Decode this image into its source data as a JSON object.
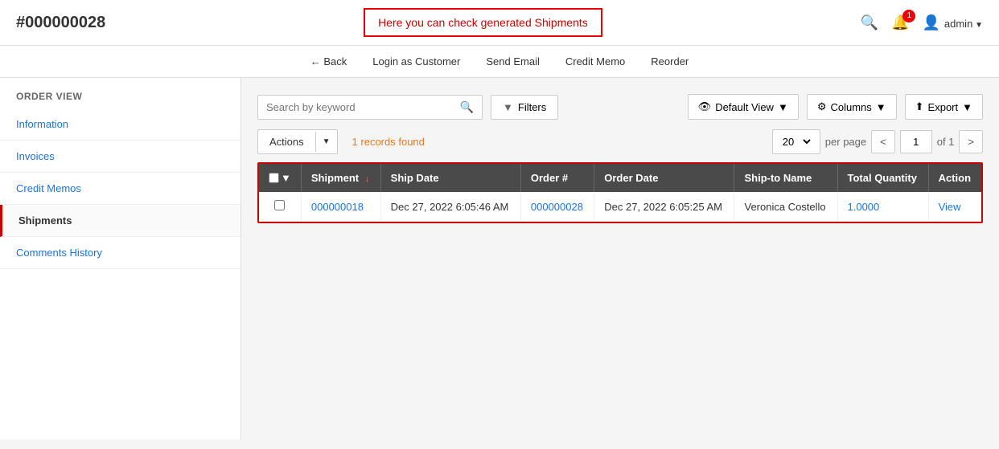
{
  "header": {
    "order_id": "#000000028",
    "tooltip": "Here you can check generated Shipments",
    "search_icon": "🔍",
    "notification_count": "1",
    "admin_label": "admin"
  },
  "action_bar": {
    "back": "← Back",
    "login_customer": "Login as Customer",
    "send_email": "Send Email",
    "credit_memo": "Credit Memo",
    "reorder": "Reorder"
  },
  "sidebar": {
    "section_title": "ORDER VIEW",
    "items": [
      {
        "label": "Information",
        "active": false
      },
      {
        "label": "Invoices",
        "active": false
      },
      {
        "label": "Credit Memos",
        "active": false
      },
      {
        "label": "Shipments",
        "active": true
      },
      {
        "label": "Comments History",
        "active": false
      }
    ]
  },
  "toolbar": {
    "search_placeholder": "Search by keyword",
    "filters_label": "Filters",
    "default_view_label": "Default View",
    "columns_label": "Columns",
    "export_label": "Export"
  },
  "records_bar": {
    "actions_label": "Actions",
    "records_text": "1 records found",
    "per_page": "20",
    "page_of": "of 1",
    "current_page": "1"
  },
  "table": {
    "columns": [
      {
        "label": "",
        "key": "checkbox"
      },
      {
        "label": "Shipment",
        "key": "shipment",
        "sortable": true
      },
      {
        "label": "Ship Date",
        "key": "ship_date"
      },
      {
        "label": "Order #",
        "key": "order_num"
      },
      {
        "label": "Order Date",
        "key": "order_date"
      },
      {
        "label": "Ship-to Name",
        "key": "ship_to_name"
      },
      {
        "label": "Total Quantity",
        "key": "total_quantity"
      },
      {
        "label": "Action",
        "key": "action"
      }
    ],
    "rows": [
      {
        "shipment": "000000018",
        "ship_date": "Dec 27, 2022 6:05:46 AM",
        "order_num": "000000028",
        "order_date": "Dec 27, 2022 6:05:25 AM",
        "ship_to_name": "Veronica Costello",
        "total_quantity": "1.0000",
        "action": "View"
      }
    ]
  }
}
